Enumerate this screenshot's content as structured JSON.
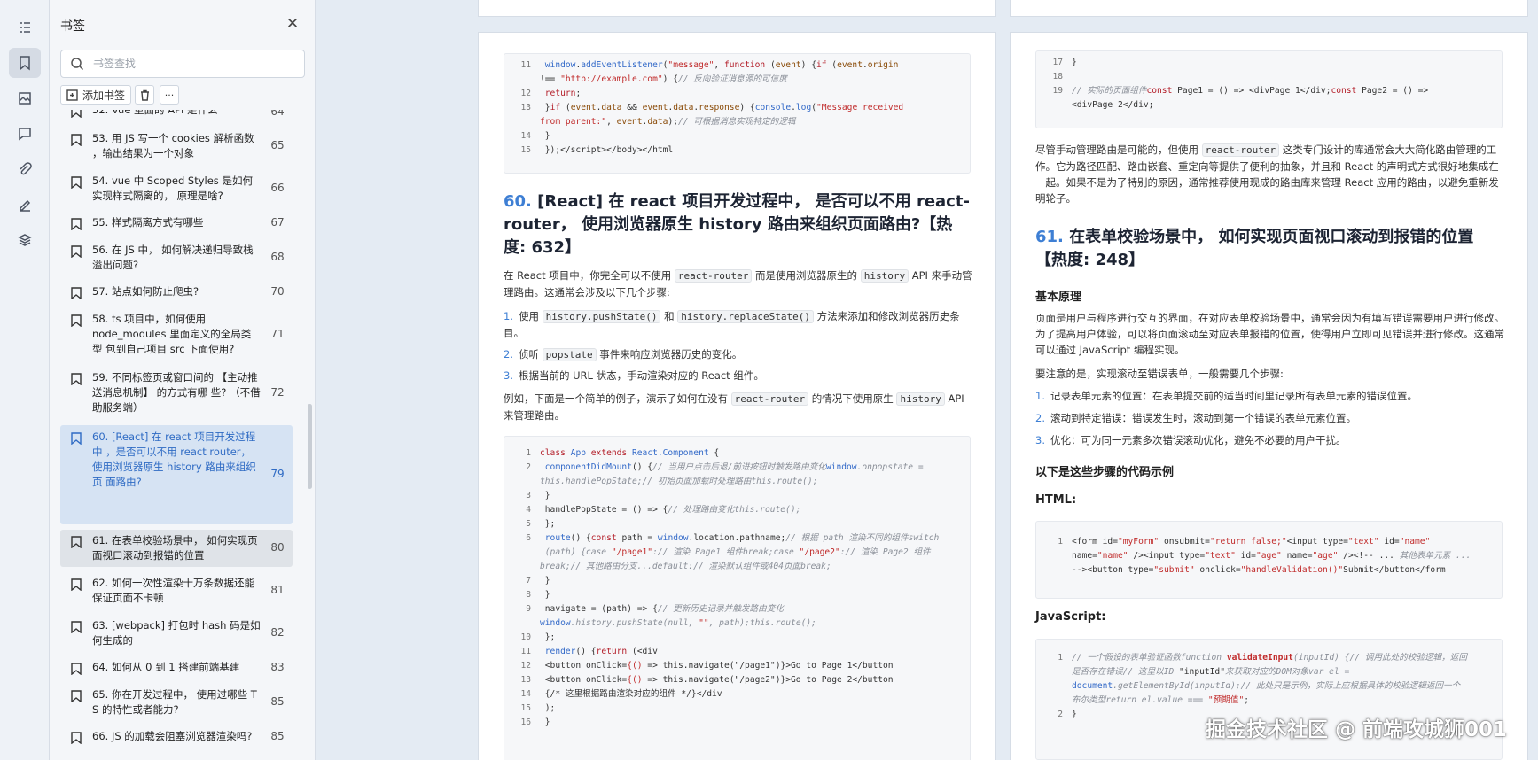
{
  "rail": {
    "icons": [
      "outline-icon",
      "bookmark-icon",
      "thumbnail-icon",
      "comment-icon",
      "attachment-icon",
      "signature-icon",
      "layers-icon"
    ]
  },
  "panel": {
    "title": "书签",
    "search_placeholder": "书签查找",
    "add_bookmark_label": "添加书签",
    "more_label": "···",
    "items": [
      {
        "text": "52. Vue 重面的 API 是什么",
        "page": "64"
      },
      {
        "text": "53. 用 JS 写一个 cookies 解析函数 ，输出结果为一个对象",
        "page": "65"
      },
      {
        "text": "54. vue 中 Scoped Styles 是如何实现样式隔离的， 原理是啥?",
        "page": "66"
      },
      {
        "text": "55. 样式隔离方式有哪些",
        "page": "67"
      },
      {
        "text": "56. 在 JS 中， 如何解决递归导致栈溢出问题?",
        "page": "68"
      },
      {
        "text": "57. 站点如何防止爬虫?",
        "page": "70"
      },
      {
        "text": "58. ts 项目中，如何使用 node_modules 里面定义的全局类型 包到自己项目 src 下面使用?",
        "page": "71"
      },
      {
        "text": "59. 不同标签页或窗口间的 【主动推送消息机制】 的方式有哪 些? （不借助服务端）",
        "page": "72"
      },
      {
        "text": "60. [React] 在 react 项目开发过程中 ，是否可以不用 react router， 使用浏览器原生 history 路由来组织页 面路由?",
        "page": "79"
      },
      {
        "text": "61. 在表单校验场景中， 如何实现页 面视口滚动到报错的位置",
        "page": "80"
      },
      {
        "text": "62. 如何一次性渲染十万条数据还能 保证页面不卡顿",
        "page": "81"
      },
      {
        "text": "63. [webpack] 打包时 hash 码是如 何生成的",
        "page": "82"
      },
      {
        "text": "64. 如何从 0 到 1 搭建前端基建",
        "page": "83"
      },
      {
        "text": "65. 你在开发过程中， 使用过哪些 T S 的特性或者能力?",
        "page": "85"
      },
      {
        "text": "66. JS 的加载会阻塞浏览器渲染吗?",
        "page": "85"
      }
    ]
  },
  "left_page": {
    "code1_lines": [
      {
        "n": "11",
        "html": "        <span class=\"fn\">window</span>.<span class=\"fn\">addEventListener</span>(<span class=\"str\">\"message\"</span>, <span class=\"kw\">function</span> (<span class=\"prop\">event</span>) {<span class=\"kw\">if</span> (<span class=\"prop\">event</span>.<span class=\"prop\">origin</span>"
      },
      {
        "n": "",
        "html": "!== <span class=\"str\">\"http://example.com\"</span>) {<span class=\"cm\">// 反向验证消息源的可信度</span>"
      },
      {
        "n": "12",
        "html": "          <span class=\"kw\">return</span>;"
      },
      {
        "n": "13",
        "html": "        }<span class=\"kw\">if</span> (<span class=\"prop\">event</span>.<span class=\"prop\">data</span> &amp;&amp; <span class=\"prop\">event</span>.<span class=\"prop\">data</span>.<span class=\"prop\">response</span>) {<span class=\"fn\">console</span>.<span class=\"fn\">log</span>(<span class=\"str\">\"Message received</span>"
      },
      {
        "n": "",
        "html": "<span class=\"str\">from parent:\"</span>, <span class=\"prop\">event</span>.<span class=\"prop\">data</span>);<span class=\"cm\">// 可根据消息实现特定的逻辑</span>"
      },
      {
        "n": "14",
        "html": "        }"
      },
      {
        "n": "15",
        "html": "      });&lt;/script&gt;&lt;/body&gt;&lt;/html"
      }
    ],
    "section_num": "60.",
    "section_title": "[React] 在 react 项目开发过程中， 是否可以不用 react-router， 使用浏览器原生 history 路由来组织页面路由?【热度: 632】",
    "intro_html": "在 React 项目中，你完全可以不使用 <code>react-router</code> 而是使用浏览器原生的 <code>history</code> API 来手动管理路由。这通常会涉及以下几个步骤:",
    "steps": [
      {
        "num": "1.",
        "html": "使用 <code>history.pushState()</code> 和 <code>history.replaceState()</code> 方法来添加和修改浏览器历史条目。"
      },
      {
        "num": "2.",
        "html": "侦听 <code>popstate</code> 事件来响应浏览器历史的变化。"
      },
      {
        "num": "3.",
        "html": "根据当前的 URL 状态，手动渲染对应的 React 组件。"
      }
    ],
    "example_html": "例如，下面是一个简单的例子，演示了如何在没有 <code>react-router</code> 的情况下使用原生 <code>history</code> API 来管理路由。",
    "code2_lines": [
      {
        "n": "1",
        "html": "<span class=\"kw\">class</span> <span class=\"fn\">App</span> <span class=\"kw\">extends</span> <span class=\"fn\">React.Component</span> {"
      },
      {
        "n": "2",
        "html": "  <span class=\"fn\">componentDidMount</span>() {<span class=\"cm\">// 当用户点击后退/前进按钮时触发路由变化</span><span class=\"fn\">window</span><span class=\"cm\">.onpopstate =</span>"
      },
      {
        "n": "",
        "html": "<span class=\"cm\">this.handlePopState;// 初始页面加载时处理路由this.route();</span>"
      },
      {
        "n": "3",
        "html": "  }"
      },
      {
        "n": "4",
        "html": "  handlePopState = () =&gt; {<span class=\"cm\">// 处理路由变化this.route();</span>"
      },
      {
        "n": "5",
        "html": "  };"
      },
      {
        "n": "6",
        "html": "  <span class=\"fn\">route</span>() {<span class=\"kw\">const</span> path = <span class=\"fn\">window</span>.location.pathname;<span class=\"cm\">// 根据 path 渲染不同的组件switch</span>"
      },
      {
        "n": "",
        "html": "<span class=\"cm\">  (path) {case </span><span class=\"str\">\"/page1\"</span><span class=\"cm\">:// 渲染 Page1 组件break;case </span><span class=\"str\">\"/page2\"</span><span class=\"cm\">:// 渲染 Page2 组件</span>"
      },
      {
        "n": "",
        "html": "<span class=\"cm\">break;// 其他路由分支...default:// 渲染默认组件或404页面break;</span>"
      },
      {
        "n": "7",
        "html": "    }"
      },
      {
        "n": "8",
        "html": "  }"
      },
      {
        "n": "9",
        "html": "  navigate = (path) =&gt; {<span class=\"cm\">// 更新历史记录并触发路由变化</span>"
      },
      {
        "n": "",
        "html": "<span class=\"fn\">window</span><span class=\"cm\">.history.pushState(null, </span><span class=\"str\">\"\"</span><span class=\"cm\">, path);this.route();</span>"
      },
      {
        "n": "10",
        "html": "  };"
      },
      {
        "n": "11",
        "html": "  <span class=\"fn\">render</span>() {<span class=\"kw\">return</span> (&lt;div"
      },
      {
        "n": "12",
        "html": "        &lt;button onClick=<span class=\"str\">{()</span> =&gt; this.navigate(\"/page1\")}&gt;Go to Page 1&lt;/button"
      },
      {
        "n": "13",
        "html": "        &lt;button onClick=<span class=\"str\">{()</span> =&gt; this.navigate(\"/page2\")}&gt;Go to Page 2&lt;/button"
      },
      {
        "n": "14",
        "html": "        {/* 这里根据路由渲染对应的组件 */}&lt;/div"
      },
      {
        "n": "15",
        "html": "    );"
      },
      {
        "n": "16",
        "html": "  }"
      }
    ]
  },
  "right_page": {
    "code1_lines": [
      {
        "n": "17",
        "html": "}"
      },
      {
        "n": "18",
        "html": ""
      },
      {
        "n": "19",
        "html": "<span class=\"cm\">// 实际的页面组件</span><span class=\"kw\">const</span> Page1 = () =&gt; &lt;divPage 1&lt;/div;<span class=\"kw\">const</span> Page2 = () =&gt;"
      },
      {
        "n": "",
        "html": "&lt;divPage 2&lt;/div;"
      }
    ],
    "para1_html": "尽管手动管理路由是可能的，但使用 <code>react-router</code> 这类专门设计的库通常会大大简化路由管理的工作。它为路径匹配、路由嵌套、重定向等提供了便利的抽象，并且和 React 的声明式方式很好地集成在一起。如果不是为了特别的原因，通常推荐使用现成的路由库来管理 React 应用的路由，以避免重新发明轮子。",
    "section_num": "61.",
    "section_title": "在表单校验场景中， 如何实现页面视口滚动到报错的位置【热度: 248】",
    "basic_heading": "基本原理",
    "para2": "页面是用户与程序进行交互的界面，在对应表单校验场景中，通常会因为有填写错误需要用户进行修改。为了提高用户体验，可以将页面滚动至对应表单报错的位置，使得用户立即可见错误并进行修改。这通常可以通过 JavaScript 编程实现。",
    "para3": "要注意的是，实现滚动至错误表单，一般需要几个步骤:",
    "steps": [
      {
        "num": "1.",
        "html": "记录表单元素的位置：在表单提交前的适当时间里记录所有表单元素的错误位置。"
      },
      {
        "num": "2.",
        "html": "滚动到特定错误：错误发生时，滚动到第一个错误的表单元素位置。"
      },
      {
        "num": "3.",
        "html": "优化：可为同一元素多次错误滚动优化，避免不必要的用户干扰。"
      }
    ],
    "code_heading": "以下是这些步骤的代码示例",
    "html_heading": "HTML:",
    "html_code_lines": [
      {
        "n": "1",
        "html": "&lt;form id=<span class=\"str\">\"myForm\"</span> onsubmit=<span class=\"str\">\"return false;\"</span>&lt;input type=<span class=\"str\">\"text\"</span> id=<span class=\"str\">\"name\"</span>"
      },
      {
        "n": "",
        "html": "name=<span class=\"str\">\"name\"</span> /&gt;&lt;input type=<span class=\"str\">\"text\"</span> id=<span class=\"str\">\"age\"</span> name=<span class=\"str\">\"age\"</span> /&gt;&lt;!-- ... <span class=\"cm\">其他表单元素 ...</span>"
      },
      {
        "n": "",
        "html": "--&gt;&lt;button type=<span class=\"str\">\"submit\"</span> onclick=<span class=\"str\">\"handleValidation()\"</span>Submit&lt;/button&lt;/form"
      }
    ],
    "js_heading": "JavaScript:",
    "js_code_lines": [
      {
        "n": "1",
        "html": "<span class=\"cm\">// 一个假设的表单验证函数function </span><span class=\"str\"><b>validateInput</b></span><span class=\"cm\">(inputId) {// 调用此处的校验逻辑，返回</span>"
      },
      {
        "n": "",
        "html": "<span class=\"cm\">是否存在错误// 这里以ID </span>\"inputId\"<span class=\"cm\">来获取对应的DOM对象var el =</span>"
      },
      {
        "n": "",
        "html": "<span class=\"fn\">document</span><span class=\"cm\">.getElementById(inputId);// 此处只是示例，实际上应根据具体的校验逻辑返回一个</span>"
      },
      {
        "n": "",
        "html": "<span class=\"cm\">布尔类型return el.value === </span><span class=\"str\">\"预期值\"</span>;"
      },
      {
        "n": "2",
        "html": "}"
      }
    ]
  },
  "watermark": "掘金技术社区 @ 前端攻城狮001"
}
